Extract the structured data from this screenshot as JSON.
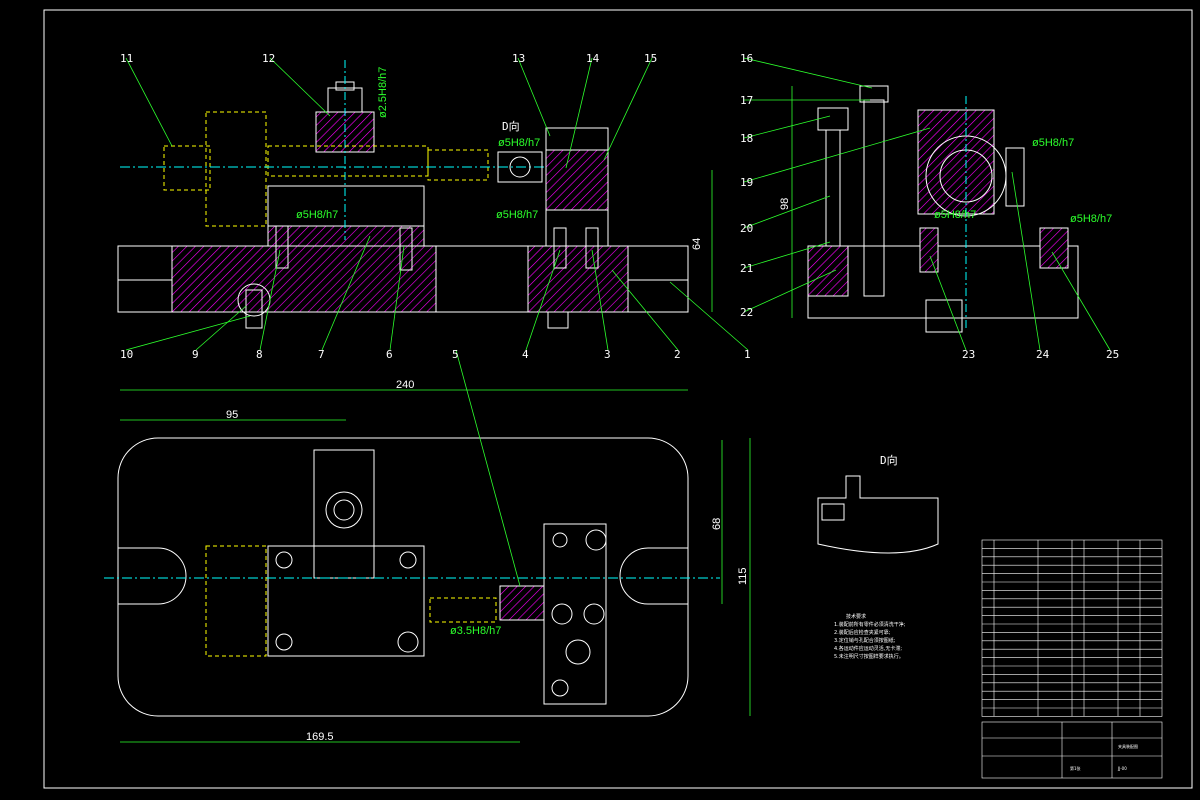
{
  "colors": {
    "background": "#000000",
    "outline": "#ffffff",
    "leader": "#2cff2c",
    "centerline": "#00ffff",
    "hatch": "#ff00ff",
    "hidden": "#ffff00"
  },
  "balloons": [
    "1",
    "2",
    "3",
    "4",
    "5",
    "6",
    "7",
    "8",
    "9",
    "10",
    "11",
    "12",
    "13",
    "14",
    "15",
    "16",
    "17",
    "18",
    "19",
    "20",
    "21",
    "22",
    "23",
    "24",
    "25"
  ],
  "balloon_16_top": "16",
  "view_labels": {
    "d_view_a": "D向",
    "d_view_b": "D向"
  },
  "dimensions": {
    "d64": "64",
    "d98": "98",
    "d240": "240",
    "d95": "95",
    "d68": "68",
    "d115": "115",
    "d169": "169.5",
    "fit_a": "ø5H8/h7",
    "fit_b": "ø5H8/h7",
    "fit_c": "ø5H8/h7",
    "fit_d": "ø5H8/h7",
    "fit_e": "ø5H8/h7",
    "fit_f": "ø3.5H8/h7",
    "fit_v": "ø2.5H8/h7"
  },
  "notes": {
    "title": "技术要求",
    "lines": [
      "1.装配前所有零件必须清洗干净;",
      "2.装配后应检查夹紧可靠;",
      "3.定位销与孔配合须按图纸;",
      "4.各运动件应运动灵活,无卡滞;",
      "5.未注明尺寸按图样要求执行。"
    ]
  },
  "bom_rows": 21,
  "title_block": {
    "name": "夹具装配图",
    "sheet": "第1张",
    "drawing_no": "JJ-00"
  }
}
